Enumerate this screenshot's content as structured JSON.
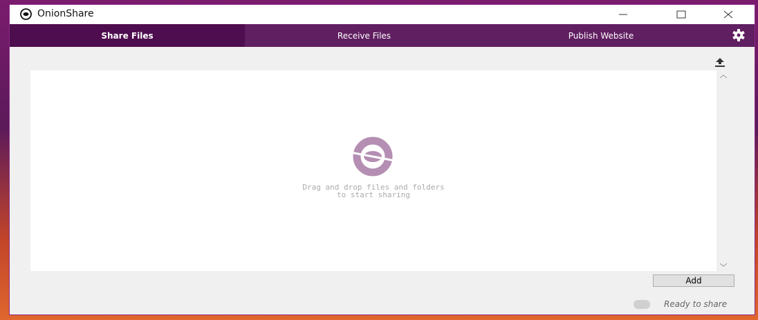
{
  "window": {
    "title": "OnionShare"
  },
  "tabs": [
    {
      "label": "Share Files",
      "active": true
    },
    {
      "label": "Receive Files",
      "active": false
    },
    {
      "label": "Publish Website",
      "active": false
    }
  ],
  "drop_area": {
    "line1": "Drag and drop files and folders",
    "line2": "to start sharing"
  },
  "buttons": {
    "add": "Add"
  },
  "status": {
    "text": "Ready to share"
  },
  "icons": {
    "app": "onionshare-logo-icon",
    "minimize": "minimize-icon",
    "maximize": "maximize-icon",
    "close": "close-icon",
    "settings": "gear-icon",
    "share": "upload-icon",
    "drop": "onionshare-drop-logo-icon"
  },
  "colors": {
    "tabbar": "#601f61",
    "tab_active": "#4e0d4e",
    "drop_logo": "#b58eb3",
    "status_dot": "#d0d0d0"
  }
}
